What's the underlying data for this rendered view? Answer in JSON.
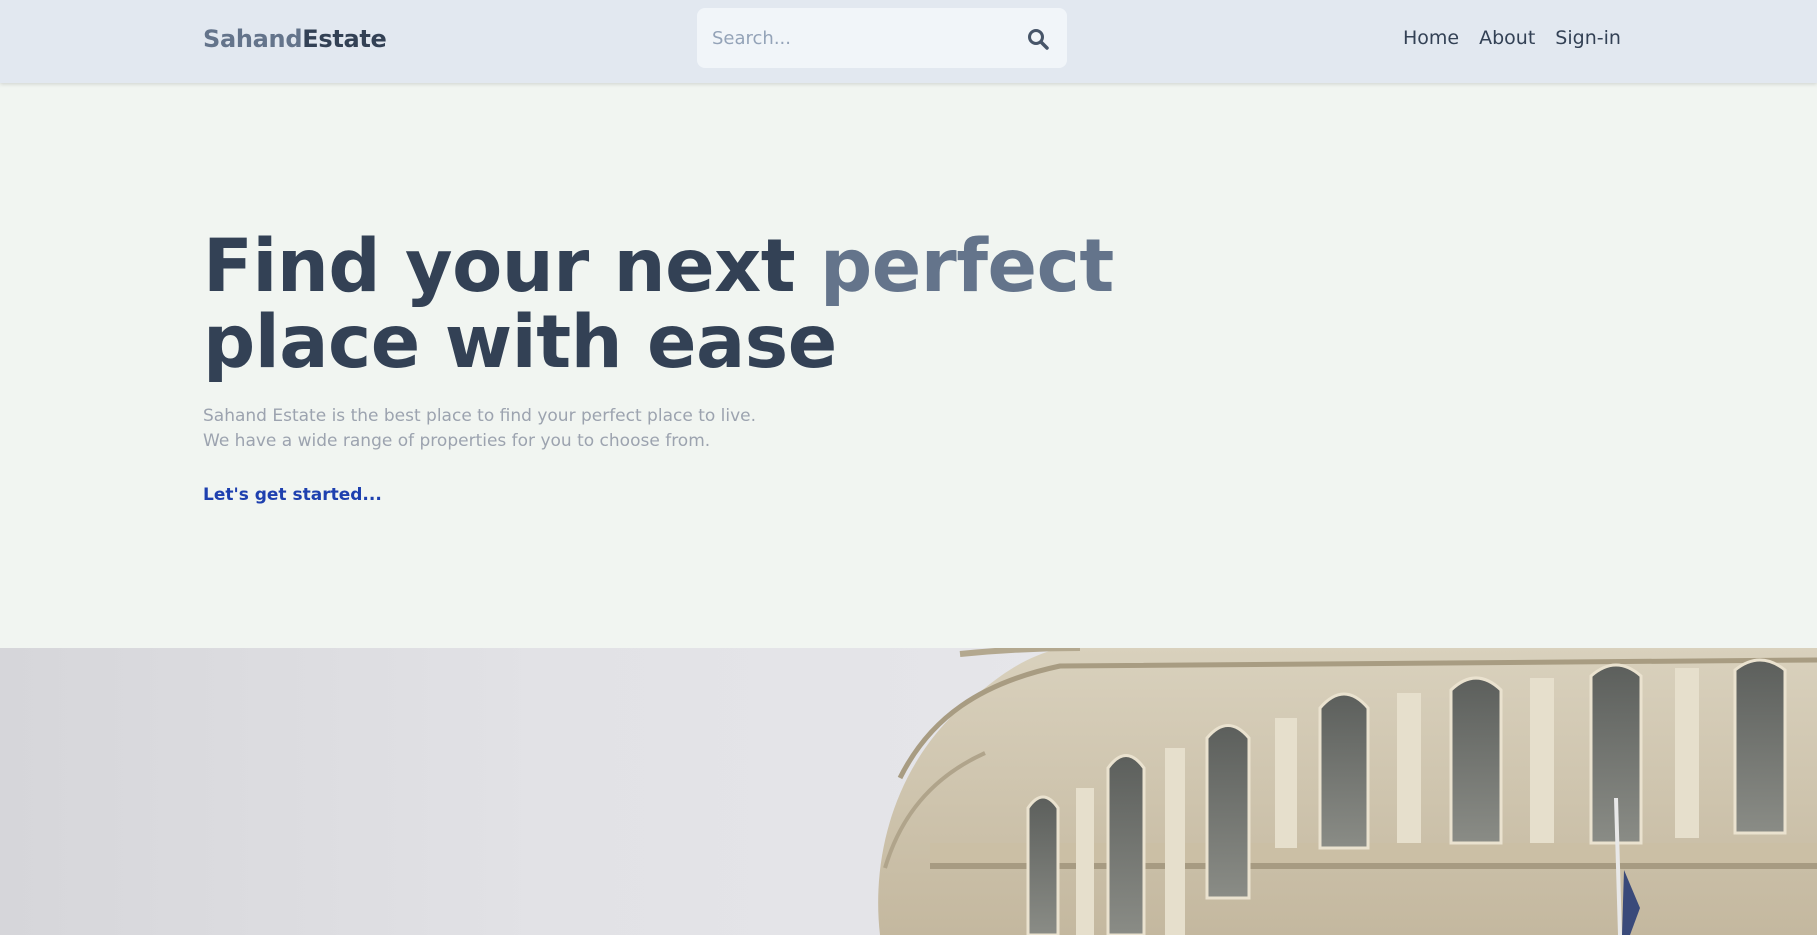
{
  "header": {
    "logo_part1": "Sahand",
    "logo_part2": "Estate",
    "search_placeholder": "Search...",
    "nav": [
      "Home",
      "About",
      "Sign-in"
    ]
  },
  "hero": {
    "headline_part1": "Find your next ",
    "headline_accent": "perfect",
    "headline_part2": "place with ease",
    "subtext_line1": "Sahand Estate is the best place to find your perfect place to live.",
    "subtext_line2": "We have a wide range of properties for you to choose from.",
    "cta": "Let's get started..."
  },
  "colors": {
    "header_bg": "#e2e8f0",
    "page_bg": "#f1f5f1",
    "text_dark": "#334155",
    "text_accent": "#64748b",
    "cta": "#1e40af"
  },
  "icons": {
    "search": "search-icon"
  }
}
